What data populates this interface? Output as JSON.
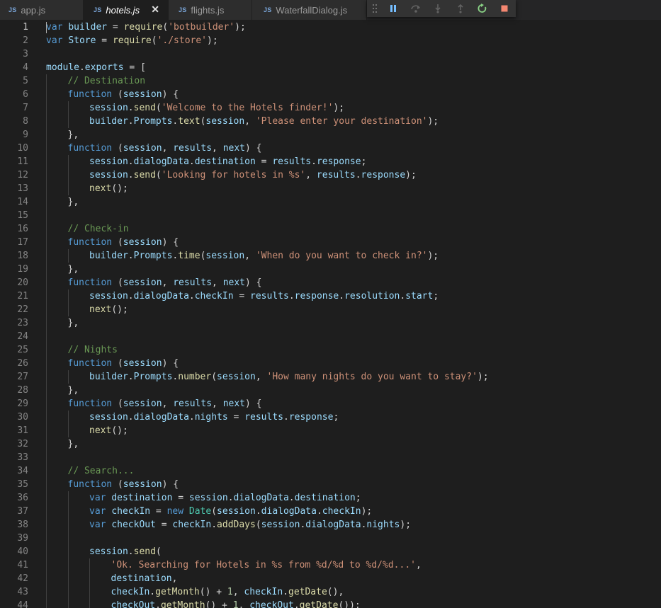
{
  "tabs": [
    {
      "icon": "JS",
      "label": "app.js",
      "active": false
    },
    {
      "icon": "JS",
      "label": "hotels.js",
      "active": true,
      "close": "✕"
    },
    {
      "icon": "JS",
      "label": "flights.js",
      "active": false
    },
    {
      "icon": "JS",
      "label": "WaterfallDialog.js",
      "active": false
    }
  ],
  "debug_toolbar": {
    "actions": [
      "drag-grip-icon",
      "pause-icon",
      "step-over-icon",
      "step-into-icon",
      "step-out-icon",
      "restart-icon",
      "stop-icon"
    ],
    "colors": {
      "blue": "#75beff",
      "green": "#89d185",
      "red": "#f48771",
      "grey": "#c5c5c5"
    }
  },
  "colors": {
    "keyword": "#569cd6",
    "variable": "#9cdcfe",
    "function": "#dcdcaa",
    "string": "#ce9178",
    "comment": "#6a9955",
    "class": "#4ec9b0",
    "number": "#b5cea8",
    "background": "#1e1e1e"
  },
  "code_lines": [
    {
      "n": "1",
      "indent": 0,
      "tokens": [
        [
          "k",
          "var"
        ],
        [
          "p",
          " "
        ],
        [
          "v",
          "builder"
        ],
        [
          "p",
          " = "
        ],
        [
          "f",
          "require"
        ],
        [
          "p",
          "("
        ],
        [
          "s",
          "'botbuilder'"
        ],
        [
          "p",
          ");"
        ]
      ]
    },
    {
      "n": "2",
      "indent": 0,
      "tokens": [
        [
          "k",
          "var"
        ],
        [
          "p",
          " "
        ],
        [
          "v",
          "Store"
        ],
        [
          "p",
          " = "
        ],
        [
          "f",
          "require"
        ],
        [
          "p",
          "("
        ],
        [
          "s",
          "'./store'"
        ],
        [
          "p",
          ");"
        ]
      ]
    },
    {
      "n": "3",
      "indent": 0,
      "tokens": []
    },
    {
      "n": "4",
      "indent": 0,
      "tokens": [
        [
          "v",
          "module"
        ],
        [
          "p",
          "."
        ],
        [
          "v",
          "exports"
        ],
        [
          "p",
          " = ["
        ]
      ]
    },
    {
      "n": "5",
      "indent": 1,
      "tokens": [
        [
          "c",
          "// Destination"
        ]
      ]
    },
    {
      "n": "6",
      "indent": 1,
      "tokens": [
        [
          "k",
          "function"
        ],
        [
          "p",
          " ("
        ],
        [
          "v",
          "session"
        ],
        [
          "p",
          ") {"
        ]
      ]
    },
    {
      "n": "7",
      "indent": 2,
      "tokens": [
        [
          "v",
          "session"
        ],
        [
          "p",
          "."
        ],
        [
          "f",
          "send"
        ],
        [
          "p",
          "("
        ],
        [
          "s",
          "'Welcome to the Hotels finder!'"
        ],
        [
          "p",
          ");"
        ]
      ]
    },
    {
      "n": "8",
      "indent": 2,
      "tokens": [
        [
          "v",
          "builder"
        ],
        [
          "p",
          "."
        ],
        [
          "v",
          "Prompts"
        ],
        [
          "p",
          "."
        ],
        [
          "f",
          "text"
        ],
        [
          "p",
          "("
        ],
        [
          "v",
          "session"
        ],
        [
          "p",
          ", "
        ],
        [
          "s",
          "'Please enter your destination'"
        ],
        [
          "p",
          ");"
        ]
      ]
    },
    {
      "n": "9",
      "indent": 1,
      "tokens": [
        [
          "p",
          "},"
        ]
      ]
    },
    {
      "n": "10",
      "indent": 1,
      "tokens": [
        [
          "k",
          "function"
        ],
        [
          "p",
          " ("
        ],
        [
          "v",
          "session"
        ],
        [
          "p",
          ", "
        ],
        [
          "v",
          "results"
        ],
        [
          "p",
          ", "
        ],
        [
          "v",
          "next"
        ],
        [
          "p",
          ") {"
        ]
      ]
    },
    {
      "n": "11",
      "indent": 2,
      "tokens": [
        [
          "v",
          "session"
        ],
        [
          "p",
          "."
        ],
        [
          "v",
          "dialogData"
        ],
        [
          "p",
          "."
        ],
        [
          "v",
          "destination"
        ],
        [
          "p",
          " = "
        ],
        [
          "v",
          "results"
        ],
        [
          "p",
          "."
        ],
        [
          "v",
          "response"
        ],
        [
          "p",
          ";"
        ]
      ]
    },
    {
      "n": "12",
      "indent": 2,
      "tokens": [
        [
          "v",
          "session"
        ],
        [
          "p",
          "."
        ],
        [
          "f",
          "send"
        ],
        [
          "p",
          "("
        ],
        [
          "s",
          "'Looking for hotels in %s'"
        ],
        [
          "p",
          ", "
        ],
        [
          "v",
          "results"
        ],
        [
          "p",
          "."
        ],
        [
          "v",
          "response"
        ],
        [
          "p",
          ");"
        ]
      ]
    },
    {
      "n": "13",
      "indent": 2,
      "tokens": [
        [
          "f",
          "next"
        ],
        [
          "p",
          "();"
        ]
      ]
    },
    {
      "n": "14",
      "indent": 1,
      "tokens": [
        [
          "p",
          "},"
        ]
      ]
    },
    {
      "n": "15",
      "indent": 1,
      "tokens": []
    },
    {
      "n": "16",
      "indent": 1,
      "tokens": [
        [
          "c",
          "// Check-in"
        ]
      ]
    },
    {
      "n": "17",
      "indent": 1,
      "tokens": [
        [
          "k",
          "function"
        ],
        [
          "p",
          " ("
        ],
        [
          "v",
          "session"
        ],
        [
          "p",
          ") {"
        ]
      ]
    },
    {
      "n": "18",
      "indent": 2,
      "tokens": [
        [
          "v",
          "builder"
        ],
        [
          "p",
          "."
        ],
        [
          "v",
          "Prompts"
        ],
        [
          "p",
          "."
        ],
        [
          "f",
          "time"
        ],
        [
          "p",
          "("
        ],
        [
          "v",
          "session"
        ],
        [
          "p",
          ", "
        ],
        [
          "s",
          "'When do you want to check in?'"
        ],
        [
          "p",
          ");"
        ]
      ]
    },
    {
      "n": "19",
      "indent": 1,
      "tokens": [
        [
          "p",
          "},"
        ]
      ]
    },
    {
      "n": "20",
      "indent": 1,
      "tokens": [
        [
          "k",
          "function"
        ],
        [
          "p",
          " ("
        ],
        [
          "v",
          "session"
        ],
        [
          "p",
          ", "
        ],
        [
          "v",
          "results"
        ],
        [
          "p",
          ", "
        ],
        [
          "v",
          "next"
        ],
        [
          "p",
          ") {"
        ]
      ]
    },
    {
      "n": "21",
      "indent": 2,
      "tokens": [
        [
          "v",
          "session"
        ],
        [
          "p",
          "."
        ],
        [
          "v",
          "dialogData"
        ],
        [
          "p",
          "."
        ],
        [
          "v",
          "checkIn"
        ],
        [
          "p",
          " = "
        ],
        [
          "v",
          "results"
        ],
        [
          "p",
          "."
        ],
        [
          "v",
          "response"
        ],
        [
          "p",
          "."
        ],
        [
          "v",
          "resolution"
        ],
        [
          "p",
          "."
        ],
        [
          "v",
          "start"
        ],
        [
          "p",
          ";"
        ]
      ]
    },
    {
      "n": "22",
      "indent": 2,
      "tokens": [
        [
          "f",
          "next"
        ],
        [
          "p",
          "();"
        ]
      ]
    },
    {
      "n": "23",
      "indent": 1,
      "tokens": [
        [
          "p",
          "},"
        ]
      ]
    },
    {
      "n": "24",
      "indent": 1,
      "tokens": []
    },
    {
      "n": "25",
      "indent": 1,
      "tokens": [
        [
          "c",
          "// Nights"
        ]
      ]
    },
    {
      "n": "26",
      "indent": 1,
      "tokens": [
        [
          "k",
          "function"
        ],
        [
          "p",
          " ("
        ],
        [
          "v",
          "session"
        ],
        [
          "p",
          ") {"
        ]
      ]
    },
    {
      "n": "27",
      "indent": 2,
      "tokens": [
        [
          "v",
          "builder"
        ],
        [
          "p",
          "."
        ],
        [
          "v",
          "Prompts"
        ],
        [
          "p",
          "."
        ],
        [
          "f",
          "number"
        ],
        [
          "p",
          "("
        ],
        [
          "v",
          "session"
        ],
        [
          "p",
          ", "
        ],
        [
          "s",
          "'How many nights do you want to stay?'"
        ],
        [
          "p",
          ");"
        ]
      ]
    },
    {
      "n": "28",
      "indent": 1,
      "tokens": [
        [
          "p",
          "},"
        ]
      ]
    },
    {
      "n": "29",
      "indent": 1,
      "tokens": [
        [
          "k",
          "function"
        ],
        [
          "p",
          " ("
        ],
        [
          "v",
          "session"
        ],
        [
          "p",
          ", "
        ],
        [
          "v",
          "results"
        ],
        [
          "p",
          ", "
        ],
        [
          "v",
          "next"
        ],
        [
          "p",
          ") {"
        ]
      ]
    },
    {
      "n": "30",
      "indent": 2,
      "tokens": [
        [
          "v",
          "session"
        ],
        [
          "p",
          "."
        ],
        [
          "v",
          "dialogData"
        ],
        [
          "p",
          "."
        ],
        [
          "v",
          "nights"
        ],
        [
          "p",
          " = "
        ],
        [
          "v",
          "results"
        ],
        [
          "p",
          "."
        ],
        [
          "v",
          "response"
        ],
        [
          "p",
          ";"
        ]
      ]
    },
    {
      "n": "31",
      "indent": 2,
      "tokens": [
        [
          "f",
          "next"
        ],
        [
          "p",
          "();"
        ]
      ]
    },
    {
      "n": "32",
      "indent": 1,
      "tokens": [
        [
          "p",
          "},"
        ]
      ]
    },
    {
      "n": "33",
      "indent": 1,
      "tokens": []
    },
    {
      "n": "34",
      "indent": 1,
      "tokens": [
        [
          "c",
          "// Search..."
        ]
      ]
    },
    {
      "n": "35",
      "indent": 1,
      "tokens": [
        [
          "k",
          "function"
        ],
        [
          "p",
          " ("
        ],
        [
          "v",
          "session"
        ],
        [
          "p",
          ") {"
        ]
      ]
    },
    {
      "n": "36",
      "indent": 2,
      "tokens": [
        [
          "k",
          "var"
        ],
        [
          "p",
          " "
        ],
        [
          "v",
          "destination"
        ],
        [
          "p",
          " = "
        ],
        [
          "v",
          "session"
        ],
        [
          "p",
          "."
        ],
        [
          "v",
          "dialogData"
        ],
        [
          "p",
          "."
        ],
        [
          "v",
          "destination"
        ],
        [
          "p",
          ";"
        ]
      ]
    },
    {
      "n": "37",
      "indent": 2,
      "tokens": [
        [
          "k",
          "var"
        ],
        [
          "p",
          " "
        ],
        [
          "v",
          "checkIn"
        ],
        [
          "p",
          " = "
        ],
        [
          "k",
          "new"
        ],
        [
          "p",
          " "
        ],
        [
          "t",
          "Date"
        ],
        [
          "p",
          "("
        ],
        [
          "v",
          "session"
        ],
        [
          "p",
          "."
        ],
        [
          "v",
          "dialogData"
        ],
        [
          "p",
          "."
        ],
        [
          "v",
          "checkIn"
        ],
        [
          "p",
          ");"
        ]
      ]
    },
    {
      "n": "38",
      "indent": 2,
      "tokens": [
        [
          "k",
          "var"
        ],
        [
          "p",
          " "
        ],
        [
          "v",
          "checkOut"
        ],
        [
          "p",
          " = "
        ],
        [
          "v",
          "checkIn"
        ],
        [
          "p",
          "."
        ],
        [
          "f",
          "addDays"
        ],
        [
          "p",
          "("
        ],
        [
          "v",
          "session"
        ],
        [
          "p",
          "."
        ],
        [
          "v",
          "dialogData"
        ],
        [
          "p",
          "."
        ],
        [
          "v",
          "nights"
        ],
        [
          "p",
          ");"
        ]
      ]
    },
    {
      "n": "39",
      "indent": 2,
      "tokens": []
    },
    {
      "n": "40",
      "indent": 2,
      "tokens": [
        [
          "v",
          "session"
        ],
        [
          "p",
          "."
        ],
        [
          "f",
          "send"
        ],
        [
          "p",
          "("
        ]
      ]
    },
    {
      "n": "41",
      "indent": 3,
      "tokens": [
        [
          "s",
          "'Ok. Searching for Hotels in %s from %d/%d to %d/%d...'"
        ],
        [
          "p",
          ","
        ]
      ]
    },
    {
      "n": "42",
      "indent": 3,
      "tokens": [
        [
          "v",
          "destination"
        ],
        [
          "p",
          ","
        ]
      ]
    },
    {
      "n": "43",
      "indent": 3,
      "tokens": [
        [
          "v",
          "checkIn"
        ],
        [
          "p",
          "."
        ],
        [
          "f",
          "getMonth"
        ],
        [
          "p",
          "() + "
        ],
        [
          "n",
          "1"
        ],
        [
          "p",
          ", "
        ],
        [
          "v",
          "checkIn"
        ],
        [
          "p",
          "."
        ],
        [
          "f",
          "getDate"
        ],
        [
          "p",
          "(),"
        ]
      ]
    },
    {
      "n": "44",
      "indent": 3,
      "tokens": [
        [
          "v",
          "checkOut"
        ],
        [
          "p",
          "."
        ],
        [
          "f",
          "getMonth"
        ],
        [
          "p",
          "() + "
        ],
        [
          "n",
          "1"
        ],
        [
          "p",
          ", "
        ],
        [
          "v",
          "checkOut"
        ],
        [
          "p",
          "."
        ],
        [
          "f",
          "getDate"
        ],
        [
          "p",
          "());"
        ]
      ]
    }
  ]
}
